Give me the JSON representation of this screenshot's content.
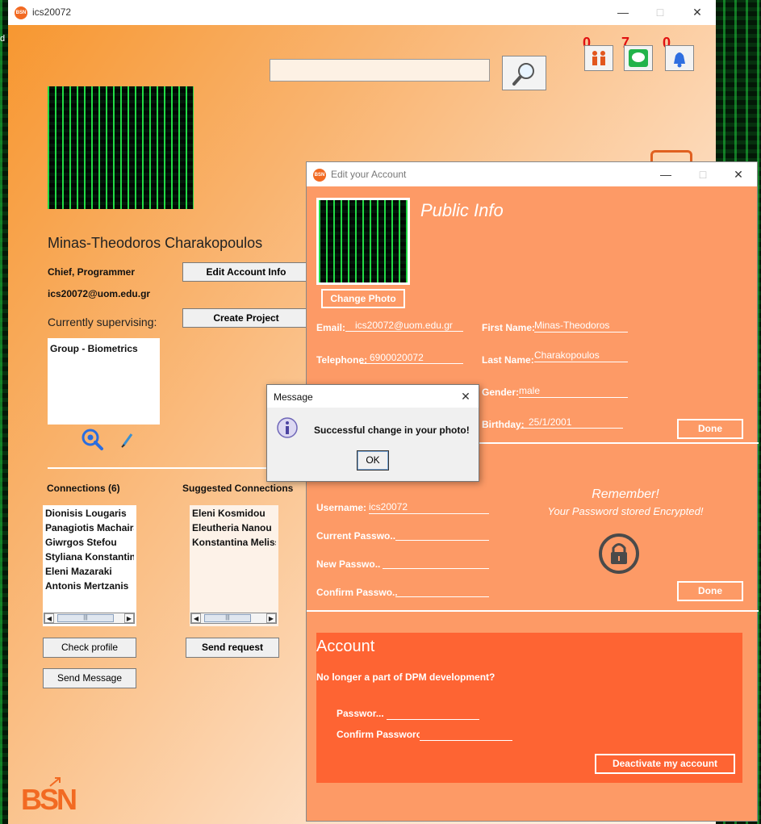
{
  "main_window": {
    "title": "ics20072",
    "search_placeholder": "",
    "badges": {
      "connections": "0",
      "messages": "7",
      "notifications": "0"
    },
    "profile": {
      "name": "Minas-Theodoros Charakopoulos",
      "role": "Chief, Programmer",
      "email": "ics20072@uom.edu.gr",
      "supervising_label": "Currently supervising:",
      "supervising_items": [
        "Group - Biometrics"
      ]
    },
    "buttons": {
      "edit_account": "Edit Account Info",
      "create_project": "Create Project",
      "check_profile": "Check profile",
      "send_request": "Send request",
      "send_message": "Send Message"
    },
    "connections": {
      "title": "Connections (6)",
      "items": [
        "Dionisis Lougaris",
        "Panagiotis Machairas",
        "Giwrgos Stefou",
        "Styliana Konstantinidou",
        "Eleni Mazaraki",
        "Antonis Mertzanis"
      ]
    },
    "suggested": {
      "title": "Suggested Connections",
      "items": [
        "Eleni Kosmidou",
        "Eleutheria Nanou",
        "Konstantina Melissa"
      ]
    },
    "logo_text": "BSN"
  },
  "background_letter": "d",
  "edit_window": {
    "title": "Edit your Account",
    "public_info_title": "Public Info",
    "change_photo": "Change Photo",
    "fields": {
      "email_label": "Email:",
      "email_value": "ics20072@uom.edu.gr",
      "telephone_label": "Telephone:",
      "telephone_value": "6900020072",
      "first_name_label": "First Name:",
      "first_name_value": "Minas-Theodoros",
      "last_name_label": "Last Name:",
      "last_name_value": "Charakopoulos",
      "gender_label": "Gender:",
      "gender_value": "male",
      "birthday_label": "Birthday:",
      "birthday_value": "25/1/2001"
    },
    "done_label": "Done",
    "password_section": {
      "username_label": "Username:",
      "username_value": "ics20072",
      "current_password_label": "Current Passwo..",
      "new_password_label": "New Passwo..",
      "confirm_password_label": "Confirm Passwo..",
      "remember_title": "Remember!",
      "remember_text": "Your Password stored Encrypted!"
    },
    "account_section": {
      "title": "Account",
      "question": "No longer a part of DPM development?",
      "password_label": "Passwor...",
      "confirm_password_label": "Confirm Passworc",
      "deactivate_label": "Deactivate my account"
    }
  },
  "dialog": {
    "title": "Message",
    "message": "Successful change in your photo!",
    "ok_label": "OK"
  }
}
